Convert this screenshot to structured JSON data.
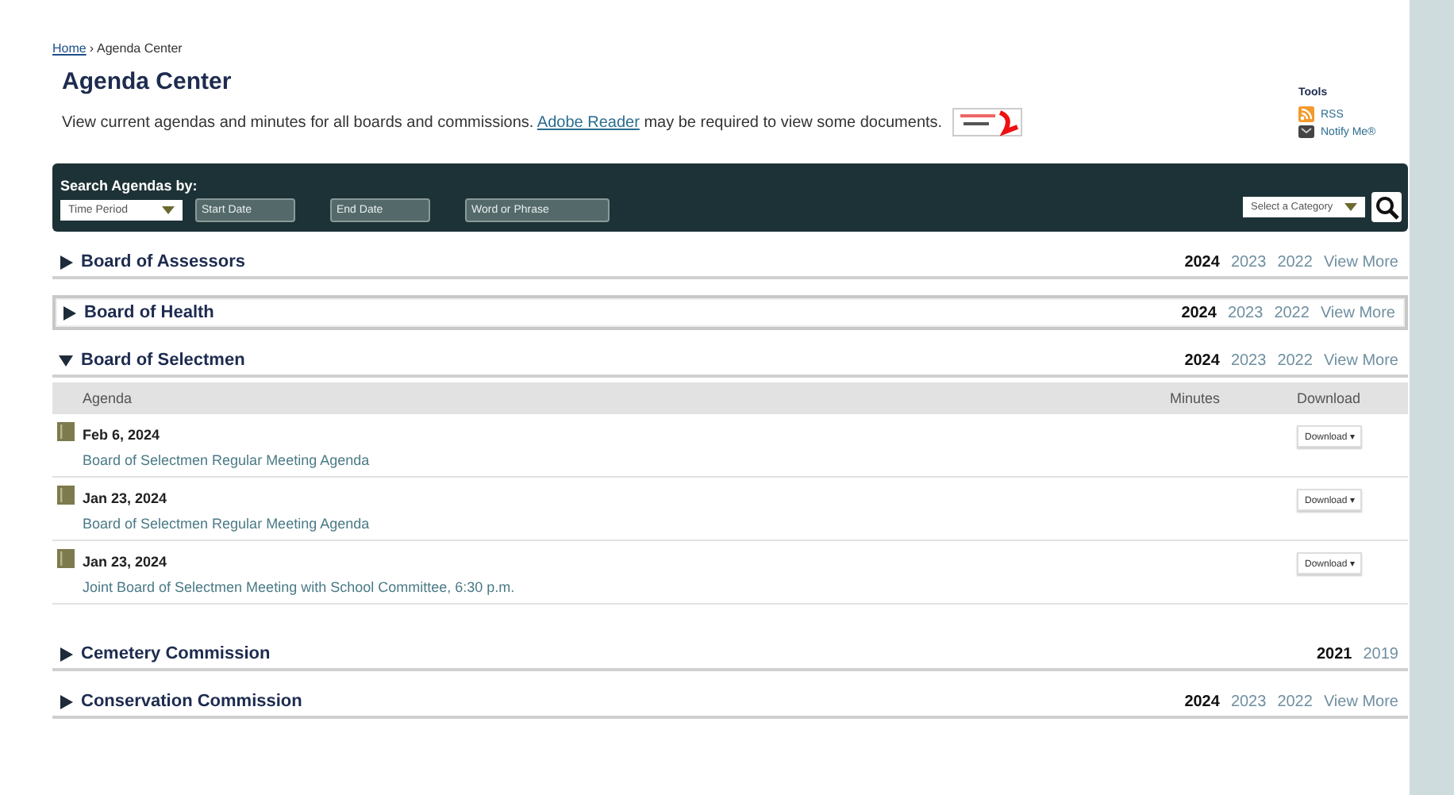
{
  "breadcrumb": {
    "links": [
      "Home"
    ],
    "separator": "›",
    "current": "Agenda Center"
  },
  "page": {
    "title": "Agenda Center",
    "description_before": "View current agendas and minutes for all boards and commissions.",
    "description_link": "Adobe Reader",
    "description_after": "may be required to view some documents."
  },
  "tools": {
    "title": "Tools",
    "items": [
      {
        "kind": "rss",
        "label": "RSS"
      },
      {
        "kind": "notify",
        "label": "Notify Me®"
      }
    ]
  },
  "search": {
    "title": "Search Agendas by:",
    "time_period": "Time Period",
    "start_placeholder": "Start Date",
    "end_placeholder": "End Date",
    "phrase_placeholder": "Word or Phrase",
    "category": "Select a Category"
  },
  "sections": [
    {
      "title": "Board of Assessors",
      "expanded": false,
      "highlighted": false,
      "years": [
        {
          "label": "2024",
          "selected": true
        },
        {
          "label": "2023",
          "selected": false
        },
        {
          "label": "2022",
          "selected": false
        }
      ],
      "more": "View More"
    },
    {
      "title": "Board of Health",
      "expanded": false,
      "highlighted": true,
      "years": [
        {
          "label": "2024",
          "selected": true
        },
        {
          "label": "2023",
          "selected": false
        },
        {
          "label": "2022",
          "selected": false
        }
      ],
      "more": "View More"
    },
    {
      "title": "Board of Selectmen",
      "expanded": true,
      "highlighted": false,
      "years": [
        {
          "label": "2024",
          "selected": true
        },
        {
          "label": "2023",
          "selected": false
        },
        {
          "label": "2022",
          "selected": false
        }
      ],
      "more": "View More",
      "table": {
        "columns": [
          "Agenda",
          "Minutes",
          "Download"
        ],
        "rows": [
          {
            "date": "Feb 6, 2024",
            "title": "Board of Selectmen Regular Meeting Agenda",
            "download": "Download ▾"
          },
          {
            "date": "Jan 23, 2024",
            "title": "Board of Selectmen Regular Meeting Agenda",
            "download": "Download ▾"
          },
          {
            "date": "Jan 23, 2024",
            "title": "Joint Board of Selectmen Meeting with School Committee, 6:30 p.m.",
            "download": "Download ▾"
          }
        ]
      }
    },
    {
      "title": "Cemetery Commission",
      "expanded": false,
      "highlighted": false,
      "years": [
        {
          "label": "2021",
          "selected": true
        },
        {
          "label": "2019",
          "selected": false
        }
      ]
    },
    {
      "title": "Conservation Commission",
      "expanded": false,
      "highlighted": false,
      "years": [
        {
          "label": "2024",
          "selected": true
        },
        {
          "label": "2023",
          "selected": false
        },
        {
          "label": "2022",
          "selected": false
        }
      ],
      "more": "View More"
    }
  ]
}
